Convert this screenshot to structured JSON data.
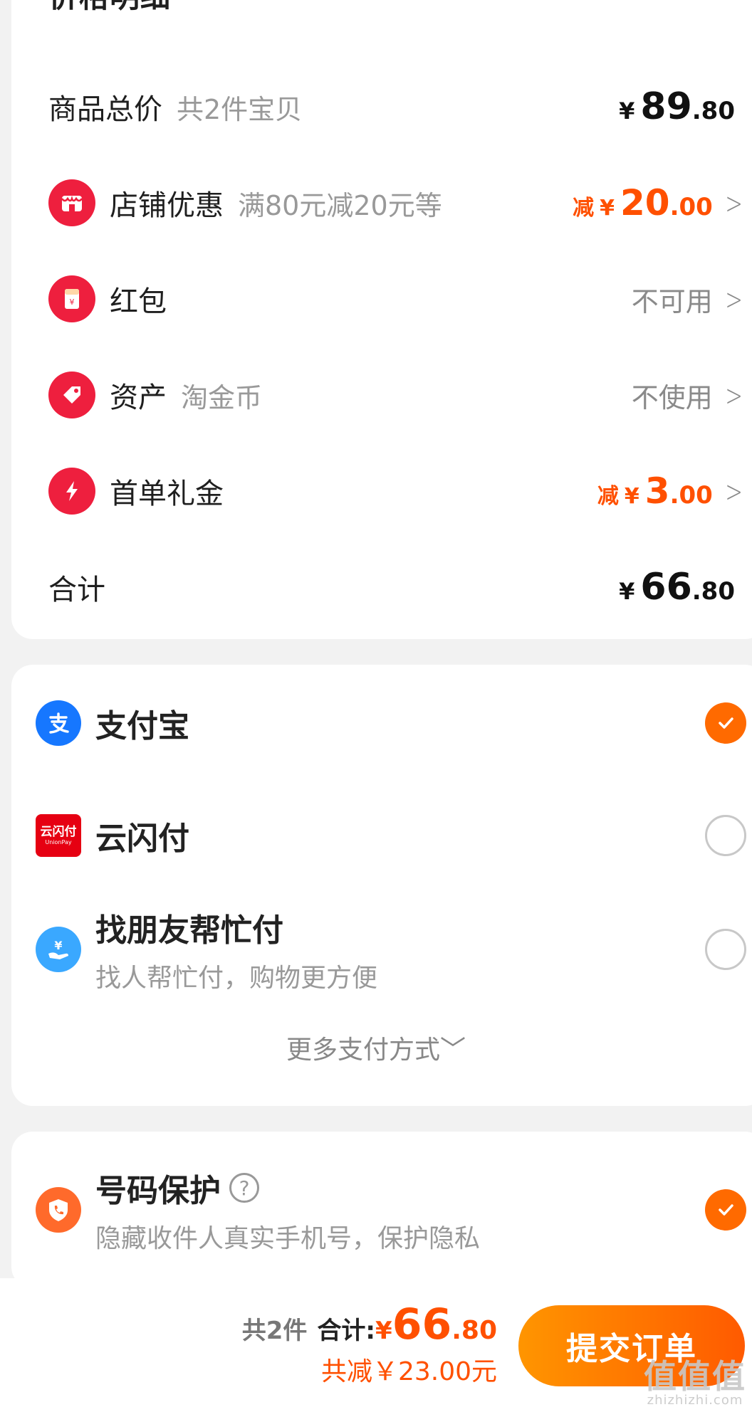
{
  "price_detail": {
    "title": "价格明细",
    "goods_total": {
      "label": "商品总价",
      "sub": "共2件宝贝",
      "yen": "¥",
      "int": "89",
      "dec": ".80"
    },
    "shop_discount": {
      "label": "店铺优惠",
      "sub": "满80元减20元等",
      "prefix": "减",
      "yen": "¥",
      "int": "20",
      "dec": ".00",
      "icon": "shop-icon"
    },
    "red_packet": {
      "label": "红包",
      "status": "不可用",
      "icon": "red-packet-icon",
      "icon_glyph": "¥"
    },
    "assets": {
      "label": "资产",
      "sub": "淘金币",
      "status": "不使用",
      "icon": "tag-icon"
    },
    "first_order": {
      "label": "首单礼金",
      "prefix": "减",
      "yen": "¥",
      "int": "3",
      "dec": ".00",
      "icon": "lightning-icon"
    },
    "total": {
      "label": "合计",
      "yen": "¥",
      "int": "66",
      "dec": ".80"
    }
  },
  "payment": {
    "methods": [
      {
        "label": "支付宝",
        "selected": true,
        "icon": "alipay-icon"
      },
      {
        "label": "云闪付",
        "selected": false,
        "icon": "unionpay-icon",
        "icon_text": "云闪付",
        "icon_sub": "UnionPay"
      },
      {
        "label": "找朋友帮忙付",
        "desc": "找人帮忙付，购物更方便",
        "selected": false,
        "icon": "friend-pay-icon"
      }
    ],
    "more": "更多支付方式﹀"
  },
  "number_protect": {
    "label": "号码保护",
    "desc": "隐藏收件人真实手机号，保护隐私",
    "checked": true,
    "help": "?"
  },
  "bottom_bar": {
    "count": "共2件",
    "total_label": "合计:",
    "yen": "¥",
    "int": "66",
    "dec": ".80",
    "saved": "共减￥23.00元",
    "submit": "提交订单"
  },
  "watermark": {
    "big": "值值值",
    "small": "zhizhizhi.com"
  },
  "colors": {
    "accent": "#ff5000",
    "red": "#ee1f3e",
    "alipay": "#1677ff"
  }
}
